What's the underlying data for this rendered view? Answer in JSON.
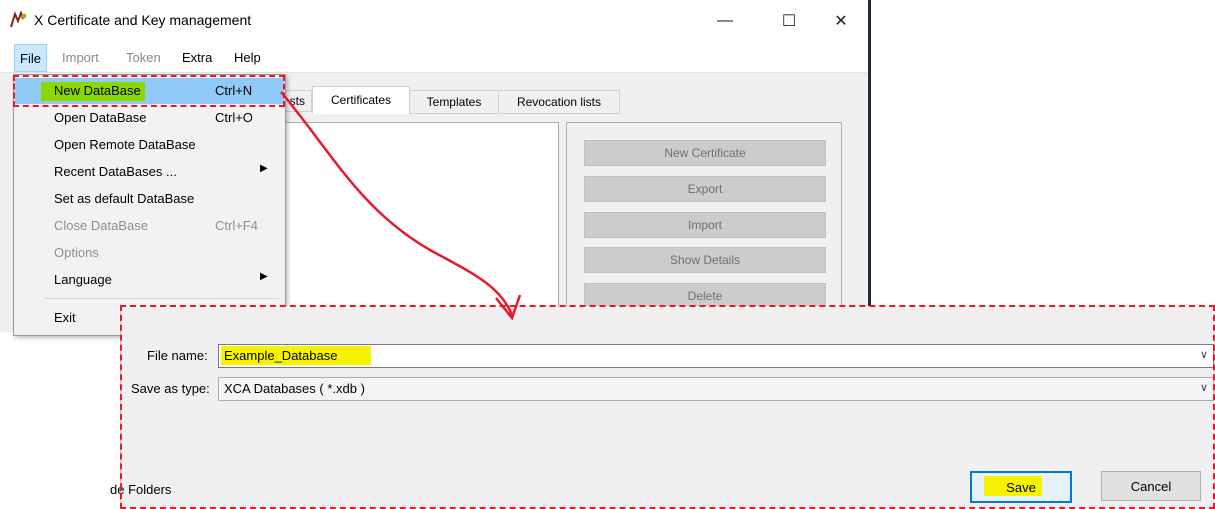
{
  "window": {
    "title": "X Certificate and Key management",
    "controls": {
      "minimize": "—",
      "maximize": "☐",
      "close": "✕"
    }
  },
  "menubar": {
    "items": [
      {
        "label": "File",
        "enabled": true
      },
      {
        "label": "Import",
        "enabled": false
      },
      {
        "label": "Token",
        "enabled": false
      },
      {
        "label": "Extra",
        "enabled": true
      },
      {
        "label": "Help",
        "enabled": true
      }
    ]
  },
  "tabs": {
    "partial": "sts",
    "items": [
      "Certificates",
      "Templates",
      "Revocation lists"
    ],
    "active": "Certificates"
  },
  "cert_buttons": [
    "New Certificate",
    "Export",
    "Import",
    "Show Details",
    "Delete"
  ],
  "file_menu": {
    "items": [
      {
        "label": "New DataBase",
        "shortcut": "Ctrl+N",
        "enabled": true,
        "highlighted": true
      },
      {
        "label": "Open DataBase",
        "shortcut": "Ctrl+O",
        "enabled": true
      },
      {
        "label": "Open Remote DataBase",
        "shortcut": "",
        "enabled": true
      },
      {
        "label": "Recent DataBases ...",
        "shortcut": "",
        "enabled": true,
        "submenu": true
      },
      {
        "label": "Set as default DataBase",
        "shortcut": "",
        "enabled": true
      },
      {
        "label": "Close DataBase",
        "shortcut": "Ctrl+F4",
        "enabled": false
      },
      {
        "label": "Options",
        "shortcut": "",
        "enabled": false
      },
      {
        "label": "Language",
        "shortcut": "",
        "enabled": true,
        "submenu": true
      },
      {
        "label": "Exit",
        "shortcut": "",
        "enabled": true
      }
    ],
    "submenu_arrow": "▶"
  },
  "save_dialog": {
    "file_name_label": "File name:",
    "file_name_value": "Example_Database",
    "save_as_type_label": "Save as type:",
    "save_as_type_value": "XCA Databases ( *.xdb )",
    "hide_folders": "de Folders",
    "save_button": "Save",
    "cancel_button": "Cancel",
    "chevron": "∨"
  },
  "colors": {
    "annotation_red": "#e8192c",
    "highlight_yellow": "#f7f300",
    "highlight_green": "#8bd800",
    "menu_hover": "#91c9f7"
  }
}
